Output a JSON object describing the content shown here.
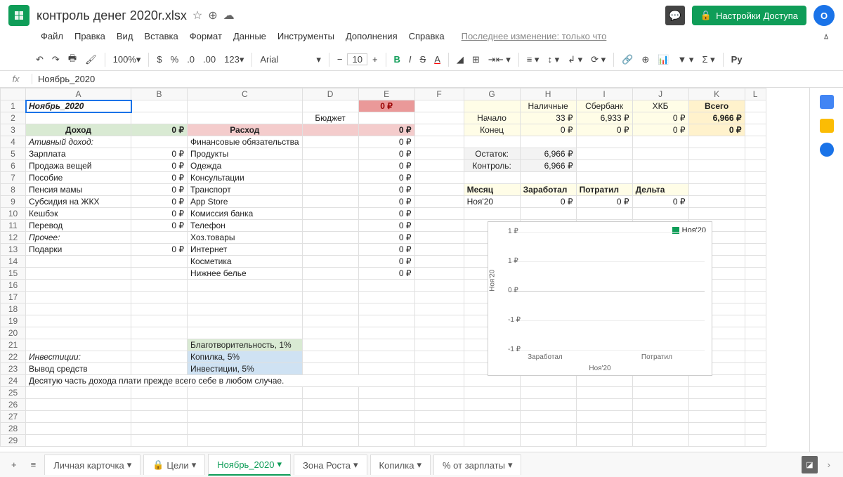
{
  "title": "контроль денег 2020r.xlsx",
  "menu": [
    "Файл",
    "Правка",
    "Вид",
    "Вставка",
    "Формат",
    "Данные",
    "Инструменты",
    "Дополнения",
    "Справка"
  ],
  "last_edit": "Последнее изменение: только что",
  "share": "Настройки Доступа",
  "avatar": "O",
  "toolbar": {
    "zoom": "100%",
    "currency": "$",
    "percent": "%",
    "dec_dec": ".0",
    "inc_dec": ".00",
    "format": "123",
    "font": "Arial",
    "size": "10"
  },
  "fx": "Ноябрь_2020",
  "columns": [
    "A",
    "B",
    "C",
    "D",
    "E",
    "F",
    "G",
    "H",
    "I",
    "J",
    "K",
    "L"
  ],
  "rows": {
    "1": {
      "A": "Ноябрь_2020",
      "E": "0 ₽",
      "H": "Наличные",
      "I": "Сбербанк",
      "J": "ХКБ",
      "K": "Всего"
    },
    "2": {
      "D": "Бюджет",
      "G": "Начало",
      "H": "33 ₽",
      "I": "6,933 ₽",
      "J": "0 ₽",
      "K": "6,966 ₽"
    },
    "3": {
      "A": "Доход",
      "B": "0 ₽",
      "C": "Расход",
      "E": "0 ₽",
      "G": "Конец",
      "H": "0 ₽",
      "I": "0 ₽",
      "J": "0 ₽",
      "K": "0 ₽"
    },
    "4": {
      "A": "Ативный доход:",
      "C": "Финансовые обязательства",
      "E": "0 ₽"
    },
    "5": {
      "A": "Зарплата",
      "B": "0 ₽",
      "C": "Продукты",
      "E": "0 ₽",
      "G": "Остаток:",
      "H": "6,966 ₽"
    },
    "6": {
      "A": "Продажа вещей",
      "B": "0 ₽",
      "C": "Одежда",
      "E": "0 ₽",
      "G": "Контроль:",
      "H": "6,966 ₽"
    },
    "7": {
      "A": "Пособие",
      "B": "0 ₽",
      "C": "Консультации",
      "E": "0 ₽"
    },
    "8": {
      "A": "Пенсия мамы",
      "B": "0 ₽",
      "C": "Транспорт",
      "E": "0 ₽",
      "G": "Месяц",
      "H": "Заработал",
      "I": "Потратил",
      "J": "Дельта"
    },
    "9": {
      "A": "Субсидия на ЖКХ",
      "B": "0 ₽",
      "C": "App Store",
      "E": "0 ₽",
      "G": "Ноя'20",
      "H": "0 ₽",
      "I": "0 ₽",
      "J": "0 ₽"
    },
    "10": {
      "A": "Кешбэк",
      "B": "0 ₽",
      "C": "Комиссия банка",
      "E": "0 ₽"
    },
    "11": {
      "A": "Перевод",
      "B": "0 ₽",
      "C": "Телефон",
      "E": "0 ₽"
    },
    "12": {
      "A": "Прочее:",
      "C": "Хоз.товары",
      "E": "0 ₽"
    },
    "13": {
      "A": "Подарки",
      "B": "0 ₽",
      "C": "Интернет",
      "E": "0 ₽"
    },
    "14": {
      "C": "Косметика",
      "E": "0 ₽"
    },
    "15": {
      "C": "Нижнее белье",
      "E": "0 ₽"
    },
    "21": {
      "C": "Благотворительность, 1%"
    },
    "22": {
      "A": "Инвестиции:",
      "C": "Копилка, 5%"
    },
    "23": {
      "A": "Вывод средств",
      "C": "Инвестиции, 5%"
    },
    "24": {
      "A": "Десятую часть дохода плати прежде всего себе в любом случае."
    }
  },
  "chart_data": {
    "type": "bar",
    "categories": [
      "Заработал",
      "Потратил"
    ],
    "series": [
      {
        "name": "Ноя'20",
        "values": [
          0,
          0
        ]
      }
    ],
    "ylim": [
      -1,
      1
    ],
    "yticks": [
      "1 ₽",
      "1 ₽",
      "0 ₽",
      "-1 ₽",
      "-1 ₽"
    ],
    "ylabel": "Ноя'20",
    "xlabel": "Ноя'20",
    "legend": "Ноя'20"
  },
  "tabs": [
    "Личная карточка",
    "Цели",
    "Ноябрь_2020",
    "Зона Роста",
    "Копилка",
    "% от зарплаты"
  ],
  "active_tab": 2
}
